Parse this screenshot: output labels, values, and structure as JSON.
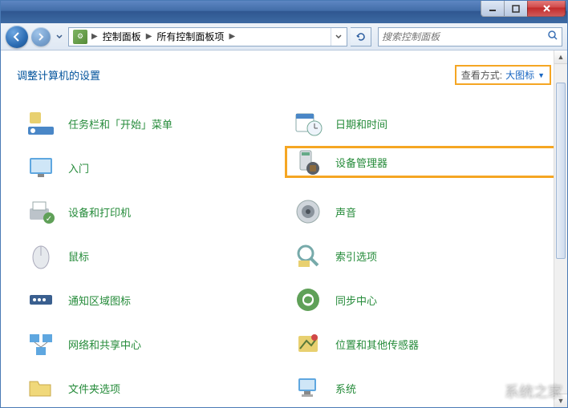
{
  "window": {
    "min_tooltip": "最小化",
    "max_tooltip": "最大化",
    "close_tooltip": "关闭"
  },
  "nav": {
    "back_tooltip": "返回",
    "forward_tooltip": "前进"
  },
  "breadcrumb": {
    "parts": [
      "控制面板",
      "所有控制面板项"
    ],
    "arrow": "▶"
  },
  "search": {
    "placeholder": "搜索控制面板"
  },
  "header": {
    "title": "调整计算机的设置",
    "viewby_label": "查看方式:",
    "viewby_value": "大图标"
  },
  "items": {
    "left": [
      {
        "label": "任务栏和「开始」菜单",
        "icon": "taskbar"
      },
      {
        "label": "入门",
        "icon": "getting-started"
      },
      {
        "label": "设备和打印机",
        "icon": "devices-printers"
      },
      {
        "label": "鼠标",
        "icon": "mouse"
      },
      {
        "label": "通知区域图标",
        "icon": "notification-area"
      },
      {
        "label": "网络和共享中心",
        "icon": "network"
      },
      {
        "label": "文件夹选项",
        "icon": "folder-options"
      }
    ],
    "right": [
      {
        "label": "日期和时间",
        "icon": "date-time"
      },
      {
        "label": "设备管理器",
        "icon": "device-manager",
        "highlight": true
      },
      {
        "label": "声音",
        "icon": "sound"
      },
      {
        "label": "索引选项",
        "icon": "indexing"
      },
      {
        "label": "同步中心",
        "icon": "sync-center"
      },
      {
        "label": "位置和其他传感器",
        "icon": "location-sensors"
      },
      {
        "label": "系统",
        "icon": "system"
      }
    ]
  },
  "watermark": "系统之家"
}
